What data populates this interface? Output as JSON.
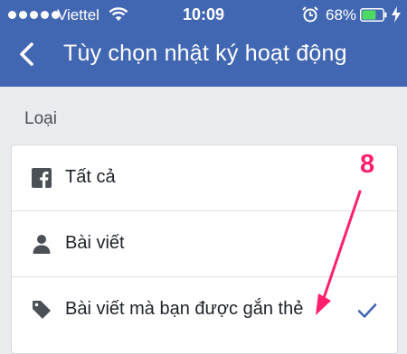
{
  "status_bar": {
    "carrier": "Viettel",
    "time": "10:09",
    "battery_percent": "68%",
    "battery_level": 0.68
  },
  "header": {
    "title": "Tùy chọn nhật ký hoạt động"
  },
  "section": {
    "label": "Loại"
  },
  "options": [
    {
      "label": "Tất cả",
      "icon": "facebook-icon",
      "selected": false
    },
    {
      "label": "Bài viết",
      "icon": "person-icon",
      "selected": false
    },
    {
      "label": "Bài viết mà bạn được gắn thẻ",
      "icon": "tag-icon",
      "selected": true
    }
  ],
  "annotation": {
    "step_number": "8",
    "color": "#ff1f6b"
  },
  "colors": {
    "header": "#4267b2",
    "check": "#4267b2"
  }
}
